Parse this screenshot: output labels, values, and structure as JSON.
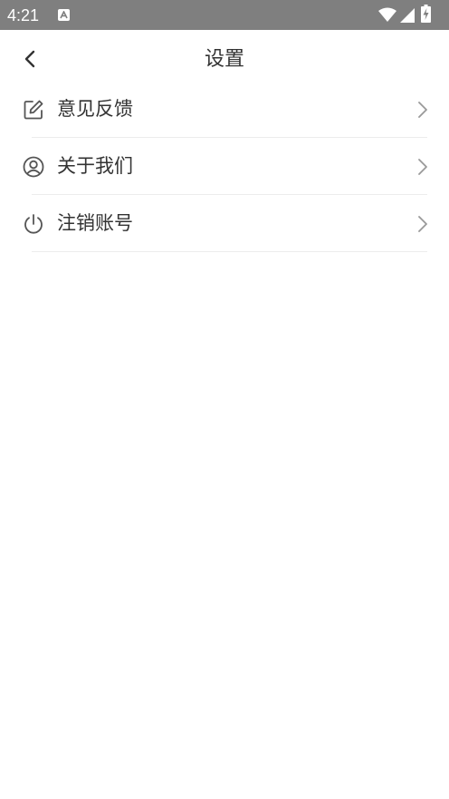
{
  "status_bar": {
    "time": "4:21",
    "notification_icon": "a-letter-icon",
    "wifi_icon": "wifi-icon",
    "signal_icon": "cell-signal-icon",
    "battery_icon": "battery-charging-icon"
  },
  "header": {
    "back_icon": "chevron-left-icon",
    "title": "设置"
  },
  "menu": {
    "items": [
      {
        "label": "意见反馈",
        "icon": "edit-icon"
      },
      {
        "label": "关于我们",
        "icon": "user-circle-icon"
      },
      {
        "label": "注销账号",
        "icon": "power-icon"
      }
    ]
  },
  "colors": {
    "status_bar_bg": "#7f7f7f",
    "text": "#333333",
    "divider": "#ececec",
    "chevron": "#999999"
  }
}
